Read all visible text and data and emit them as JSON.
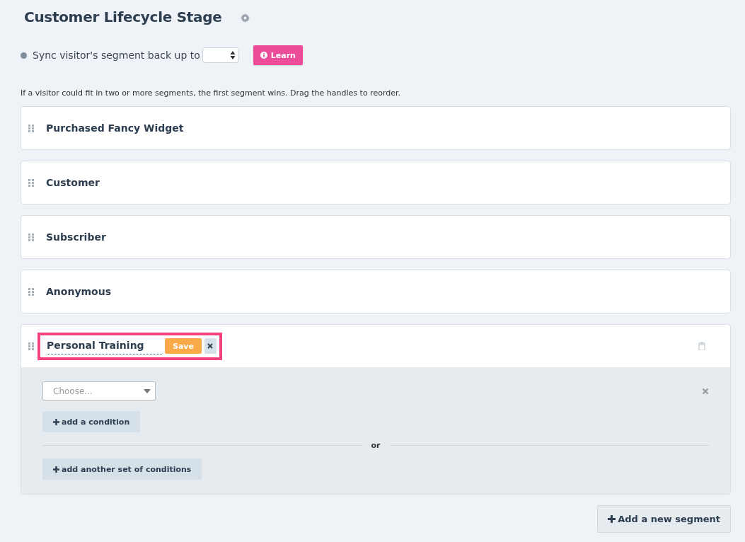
{
  "title": "Customer Lifecycle Stage",
  "sync": {
    "label": "Sync visitor's segment back up to",
    "learn_button": "Learn"
  },
  "hint": "If a visitor could fit in two or more segments, the first segment wins. Drag the handles to reorder.",
  "segments": [
    {
      "kind": "collapsed",
      "name": "Purchased Fancy Widget"
    },
    {
      "kind": "collapsed",
      "name": "Customer"
    },
    {
      "kind": "collapsed",
      "name": "Subscriber"
    },
    {
      "kind": "collapsed",
      "name": "Anonymous"
    },
    {
      "kind": "editing",
      "name": "Personal Training",
      "save_button": "Save",
      "condition_placeholder": "Choose...",
      "add_condition": "add a condition",
      "separator": "or",
      "add_set": "add another set of conditions"
    }
  ],
  "add_segment_button": "Add a new segment"
}
